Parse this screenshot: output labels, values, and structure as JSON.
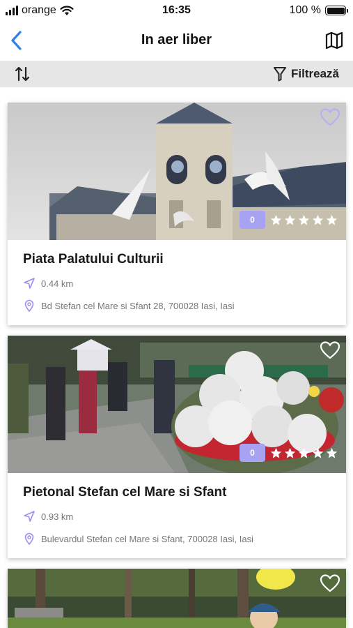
{
  "status_bar": {
    "carrier": "orange",
    "time": "16:35",
    "battery": "100 %"
  },
  "header": {
    "title": "In aer liber"
  },
  "toolbar": {
    "filter_label": "Filtrează"
  },
  "colors": {
    "accent": "#2f80ed",
    "rating_badge": "#a7a3f2",
    "icon_tint": "#9a8ef0",
    "toolbar_bg": "#e6e6e6"
  },
  "places": [
    {
      "name": "Piata Palatului Culturii",
      "distance": "0.44 km",
      "address": "Bd Stefan cel Mare si Sfant 28, 700028 Iasi, Iasi",
      "rating_badge": "0",
      "stars": 5
    },
    {
      "name": "Pietonal Stefan cel Mare si Sfant",
      "distance": "0.93 km",
      "address": "Bulevardul Stefan cel Mare si Sfant, 700028 Iasi, Iasi",
      "rating_badge": "0",
      "stars": 5
    },
    {
      "name": "",
      "distance": "",
      "address": "",
      "rating_badge": "",
      "stars": 0
    }
  ]
}
